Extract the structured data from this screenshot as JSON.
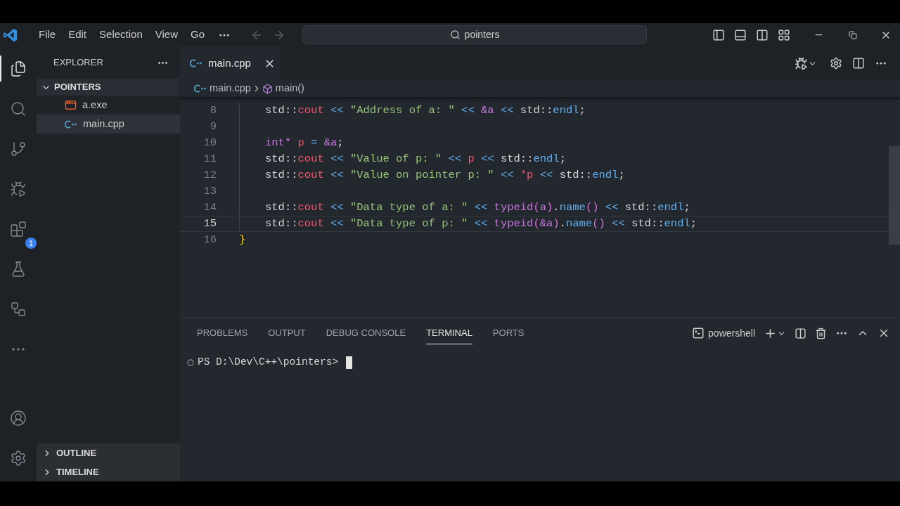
{
  "title_bar": {
    "menu": [
      "File",
      "Edit",
      "Selection",
      "View",
      "Go"
    ],
    "search": {
      "value": "pointers"
    }
  },
  "activity_bar": {
    "items": [
      {
        "kind": "files",
        "selected": true
      },
      {
        "kind": "search",
        "selected": false
      },
      {
        "kind": "source-control",
        "selected": false
      },
      {
        "kind": "run-debug",
        "selected": false
      },
      {
        "kind": "extensions",
        "selected": false,
        "badge": "1"
      },
      {
        "kind": "testing",
        "selected": false
      },
      {
        "kind": "remote",
        "selected": false
      },
      {
        "kind": "more",
        "selected": false
      }
    ],
    "bottom_items": [
      {
        "kind": "account",
        "selected": false
      },
      {
        "kind": "settings",
        "selected": false
      }
    ]
  },
  "sidebar": {
    "title": "EXPLORER",
    "folder": {
      "label": "POINTERS",
      "expanded": true,
      "children": [
        {
          "label": "a.exe",
          "kind": "exe",
          "selected": false
        },
        {
          "label": "main.cpp",
          "kind": "cpp",
          "selected": true
        }
      ]
    },
    "sections": [
      {
        "label": "OUTLINE",
        "expanded": false
      },
      {
        "label": "TIMELINE",
        "expanded": false
      }
    ]
  },
  "editor": {
    "tabs": [
      {
        "label": "main.cpp",
        "selected": true
      }
    ],
    "breadcrumb": [
      {
        "label": "main.cpp",
        "kind": "file"
      },
      {
        "label": "main()",
        "kind": "symbol"
      }
    ],
    "lines": [
      {
        "number": "8",
        "indented": true,
        "current": false,
        "tokens": [
          {
            "text": "std::",
            "kind": "plain"
          },
          {
            "text": "cout",
            "kind": "ident"
          },
          {
            "text": " << ",
            "kind": "op"
          },
          {
            "text": "\"Address of a: \"",
            "kind": "str"
          },
          {
            "text": " << ",
            "kind": "op"
          },
          {
            "text": "&a",
            "kind": "kw"
          },
          {
            "text": " << ",
            "kind": "op"
          },
          {
            "text": "std::",
            "kind": "plain"
          },
          {
            "text": "endl",
            "kind": "fn"
          },
          {
            "text": ";",
            "kind": "plain"
          }
        ]
      },
      {
        "number": "9",
        "indented": true,
        "current": false
      },
      {
        "number": "10",
        "indented": true,
        "current": false,
        "tokens": [
          {
            "text": "int*",
            "kind": "kw"
          },
          {
            "text": " p",
            "kind": "ident"
          },
          {
            "text": " = ",
            "kind": "op"
          },
          {
            "text": "&a",
            "kind": "kw"
          },
          {
            "text": ";",
            "kind": "plain"
          }
        ]
      },
      {
        "number": "11",
        "indented": true,
        "current": false,
        "tokens": [
          {
            "text": "std::",
            "kind": "plain"
          },
          {
            "text": "cout",
            "kind": "ident"
          },
          {
            "text": " << ",
            "kind": "op"
          },
          {
            "text": "\"Value of p: \"",
            "kind": "str"
          },
          {
            "text": " << ",
            "kind": "op"
          },
          {
            "text": "p",
            "kind": "ident"
          },
          {
            "text": " << ",
            "kind": "op"
          },
          {
            "text": "std::",
            "kind": "plain"
          },
          {
            "text": "endl",
            "kind": "fn"
          },
          {
            "text": ";",
            "kind": "plain"
          }
        ]
      },
      {
        "number": "12",
        "indented": true,
        "current": false,
        "tokens": [
          {
            "text": "std::",
            "kind": "plain"
          },
          {
            "text": "cout",
            "kind": "ident"
          },
          {
            "text": " << ",
            "kind": "op"
          },
          {
            "text": "\"Value on pointer p: \"",
            "kind": "str"
          },
          {
            "text": " << ",
            "kind": "op"
          },
          {
            "text": "*p",
            "kind": "ident"
          },
          {
            "text": " << ",
            "kind": "op"
          },
          {
            "text": "std::",
            "kind": "plain"
          },
          {
            "text": "endl",
            "kind": "fn"
          },
          {
            "text": ";",
            "kind": "plain"
          }
        ]
      },
      {
        "number": "13",
        "indented": true,
        "current": false
      },
      {
        "number": "14",
        "indented": true,
        "current": false,
        "tokens": [
          {
            "text": "std::",
            "kind": "plain"
          },
          {
            "text": "cout",
            "kind": "ident"
          },
          {
            "text": " << ",
            "kind": "op"
          },
          {
            "text": "\"Data type of a: \"",
            "kind": "str"
          },
          {
            "text": " << ",
            "kind": "op"
          },
          {
            "text": "typeid",
            "kind": "kw"
          },
          {
            "text": "(",
            "kind": "paren"
          },
          {
            "text": "a",
            "kind": "kw"
          },
          {
            "text": ")",
            "kind": "paren"
          },
          {
            "text": ".",
            "kind": "plain"
          },
          {
            "text": "name",
            "kind": "fn"
          },
          {
            "text": "()",
            "kind": "paren"
          },
          {
            "text": " << ",
            "kind": "op"
          },
          {
            "text": "std::",
            "kind": "plain"
          },
          {
            "text": "endl",
            "kind": "fn"
          },
          {
            "text": ";",
            "kind": "plain"
          }
        ]
      },
      {
        "number": "15",
        "indented": true,
        "current": true,
        "tokens": [
          {
            "text": "std::",
            "kind": "plain"
          },
          {
            "text": "cout",
            "kind": "ident"
          },
          {
            "text": " << ",
            "kind": "op"
          },
          {
            "text": "\"Data type of p: \"",
            "kind": "str"
          },
          {
            "text": " << ",
            "kind": "op"
          },
          {
            "text": "typeid",
            "kind": "kw"
          },
          {
            "text": "(",
            "kind": "paren"
          },
          {
            "text": "&a",
            "kind": "kw"
          },
          {
            "text": ")",
            "kind": "paren"
          },
          {
            "text": ".",
            "kind": "plain"
          },
          {
            "text": "name",
            "kind": "fn"
          },
          {
            "text": "()",
            "kind": "paren"
          },
          {
            "text": " << ",
            "kind": "op"
          },
          {
            "text": "std::",
            "kind": "plain"
          },
          {
            "text": "endl",
            "kind": "fn"
          },
          {
            "text": ";",
            "kind": "plain"
          }
        ]
      },
      {
        "number": "16",
        "indented": false,
        "current": false,
        "tokens": [
          {
            "text": "}",
            "kind": "brace"
          }
        ]
      }
    ]
  },
  "panel": {
    "tabs": [
      {
        "label": "PROBLEMS",
        "selected": false
      },
      {
        "label": "OUTPUT",
        "selected": false
      },
      {
        "label": "DEBUG CONSOLE",
        "selected": false
      },
      {
        "label": "TERMINAL",
        "selected": true
      },
      {
        "label": "PORTS",
        "selected": false
      }
    ],
    "terminal": {
      "shell": "powershell",
      "prompt": "PS D:\\Dev\\C++\\pointers>"
    }
  }
}
